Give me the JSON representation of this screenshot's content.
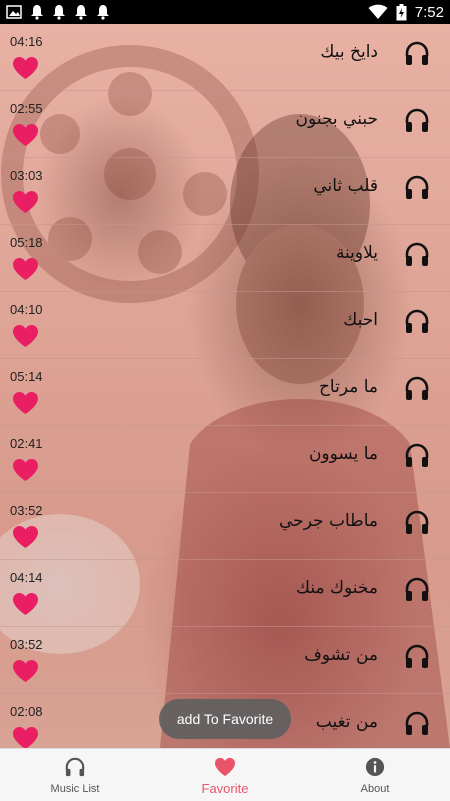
{
  "status_bar": {
    "time": "7:52",
    "icons": [
      "image-icon",
      "notification-bell-icon",
      "notification-bell-icon",
      "notification-bell-icon",
      "notification-bell-icon",
      "wifi-icon",
      "battery-charging-icon"
    ]
  },
  "songs": [
    {
      "duration": "04:16",
      "title": "دايخ بيك"
    },
    {
      "duration": "02:55",
      "title": "حبني بجنون"
    },
    {
      "duration": "03:03",
      "title": "قلب ثاني"
    },
    {
      "duration": "05:18",
      "title": "يلاوينة"
    },
    {
      "duration": "04:10",
      "title": "احبك"
    },
    {
      "duration": "05:14",
      "title": "ما مرتاح"
    },
    {
      "duration": "02:41",
      "title": "ما يسوون"
    },
    {
      "duration": "03:52",
      "title": "ماطاب جرحي"
    },
    {
      "duration": "04:14",
      "title": "مخنوك منك"
    },
    {
      "duration": "03:52",
      "title": "من تشوف"
    },
    {
      "duration": "02:08",
      "title": "من تغيب"
    }
  ],
  "toast": "add To Favorite",
  "bottom_nav": [
    {
      "label": "Music List",
      "icon": "headphones-icon"
    },
    {
      "label": "Favorite",
      "icon": "heart-icon",
      "active": true
    },
    {
      "label": "About",
      "icon": "info-icon"
    }
  ],
  "colors": {
    "heart": "#e91e63",
    "active_tab": "#e8556a"
  }
}
